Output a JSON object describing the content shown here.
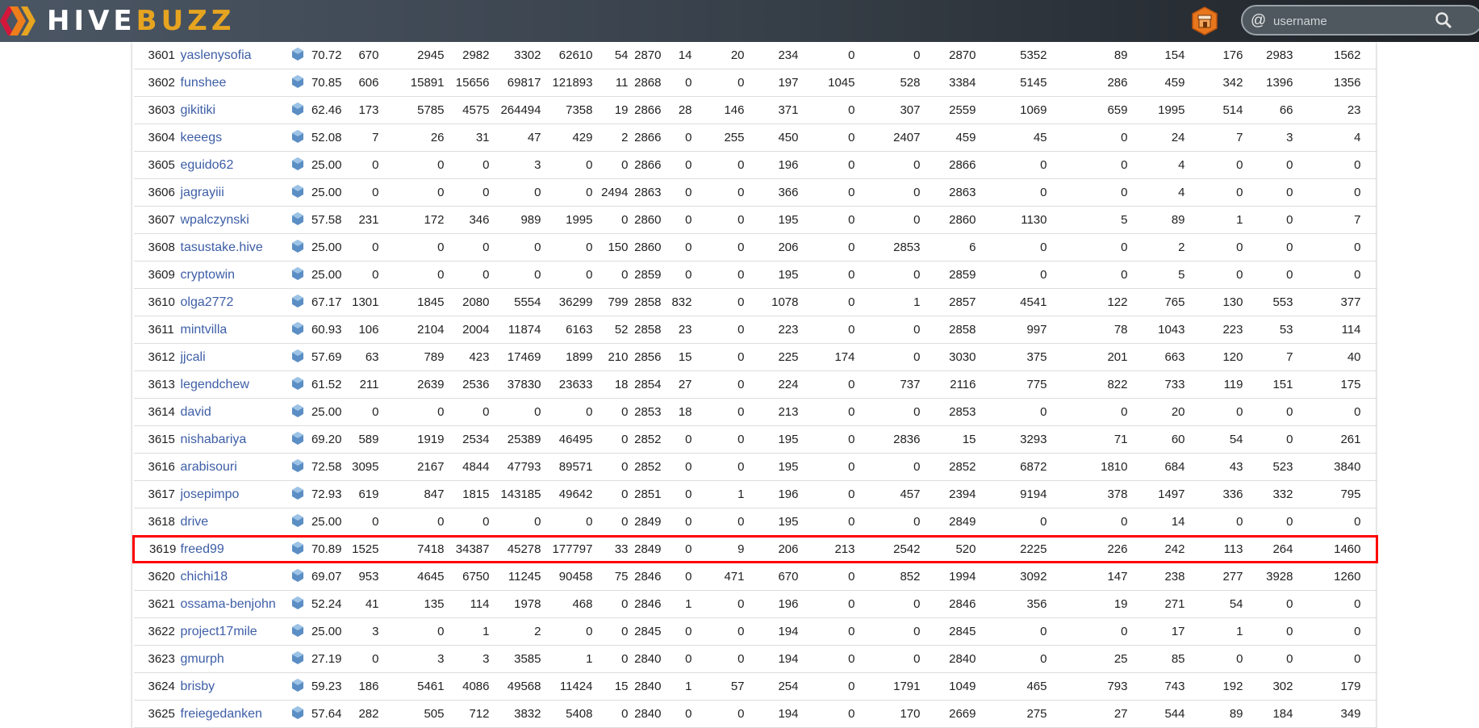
{
  "header": {
    "logo_hive": "HIVE",
    "logo_buzz": "BUZZ",
    "search": {
      "prefix": "@",
      "placeholder": "username"
    },
    "colors": {
      "brand_gold": "#e6a420",
      "link": "#3d5ea6",
      "highlight": "#ff0000"
    }
  },
  "table": {
    "highlighted_rank": "3619",
    "rows": [
      [
        "3601",
        "yaslenysofia",
        "70.72",
        "670",
        "2945",
        "2982",
        "3302",
        "62610",
        "54",
        "2870",
        "14",
        "20",
        "234",
        "0",
        "0",
        "2870",
        "5352",
        "89",
        "154",
        "176",
        "2983",
        "1562"
      ],
      [
        "3602",
        "funshee",
        "70.85",
        "606",
        "15891",
        "15656",
        "69817",
        "121893",
        "11",
        "2868",
        "0",
        "0",
        "197",
        "1045",
        "528",
        "3384",
        "5145",
        "286",
        "459",
        "342",
        "1396",
        "1356"
      ],
      [
        "3603",
        "gikitiki",
        "62.46",
        "173",
        "5785",
        "4575",
        "264494",
        "7358",
        "19",
        "2866",
        "28",
        "146",
        "371",
        "0",
        "307",
        "2559",
        "1069",
        "659",
        "1995",
        "514",
        "66",
        "23"
      ],
      [
        "3604",
        "keeegs",
        "52.08",
        "7",
        "26",
        "31",
        "47",
        "429",
        "2",
        "2866",
        "0",
        "255",
        "450",
        "0",
        "2407",
        "459",
        "45",
        "0",
        "24",
        "7",
        "3",
        "4"
      ],
      [
        "3605",
        "eguido62",
        "25.00",
        "0",
        "0",
        "0",
        "3",
        "0",
        "0",
        "2866",
        "0",
        "0",
        "196",
        "0",
        "0",
        "2866",
        "0",
        "0",
        "4",
        "0",
        "0",
        "0"
      ],
      [
        "3606",
        "jagrayiii",
        "25.00",
        "0",
        "0",
        "0",
        "0",
        "0",
        "2494",
        "2863",
        "0",
        "0",
        "366",
        "0",
        "0",
        "2863",
        "0",
        "0",
        "4",
        "0",
        "0",
        "0"
      ],
      [
        "3607",
        "wpalczynski",
        "57.58",
        "231",
        "172",
        "346",
        "989",
        "1995",
        "0",
        "2860",
        "0",
        "0",
        "195",
        "0",
        "0",
        "2860",
        "1130",
        "5",
        "89",
        "1",
        "0",
        "7"
      ],
      [
        "3608",
        "tasustake.hive",
        "25.00",
        "0",
        "0",
        "0",
        "0",
        "0",
        "150",
        "2860",
        "0",
        "0",
        "206",
        "0",
        "2853",
        "6",
        "0",
        "0",
        "2",
        "0",
        "0",
        "0"
      ],
      [
        "3609",
        "cryptowin",
        "25.00",
        "0",
        "0",
        "0",
        "0",
        "0",
        "0",
        "2859",
        "0",
        "0",
        "195",
        "0",
        "0",
        "2859",
        "0",
        "0",
        "5",
        "0",
        "0",
        "0"
      ],
      [
        "3610",
        "olga2772",
        "67.17",
        "1301",
        "1845",
        "2080",
        "5554",
        "36299",
        "799",
        "2858",
        "832",
        "0",
        "1078",
        "0",
        "1",
        "2857",
        "4541",
        "122",
        "765",
        "130",
        "553",
        "377"
      ],
      [
        "3611",
        "mintvilla",
        "60.93",
        "106",
        "2104",
        "2004",
        "11874",
        "6163",
        "52",
        "2858",
        "23",
        "0",
        "223",
        "0",
        "0",
        "2858",
        "997",
        "78",
        "1043",
        "223",
        "53",
        "114"
      ],
      [
        "3612",
        "jjcali",
        "57.69",
        "63",
        "789",
        "423",
        "17469",
        "1899",
        "210",
        "2856",
        "15",
        "0",
        "225",
        "174",
        "0",
        "3030",
        "375",
        "201",
        "663",
        "120",
        "7",
        "40"
      ],
      [
        "3613",
        "legendchew",
        "61.52",
        "211",
        "2639",
        "2536",
        "37830",
        "23633",
        "18",
        "2854",
        "27",
        "0",
        "224",
        "0",
        "737",
        "2116",
        "775",
        "822",
        "733",
        "119",
        "151",
        "175"
      ],
      [
        "3614",
        "david",
        "25.00",
        "0",
        "0",
        "0",
        "0",
        "0",
        "0",
        "2853",
        "18",
        "0",
        "213",
        "0",
        "0",
        "2853",
        "0",
        "0",
        "20",
        "0",
        "0",
        "0"
      ],
      [
        "3615",
        "nishabariya",
        "69.20",
        "589",
        "1919",
        "2534",
        "25389",
        "46495",
        "0",
        "2852",
        "0",
        "0",
        "195",
        "0",
        "2836",
        "15",
        "3293",
        "71",
        "60",
        "54",
        "0",
        "261"
      ],
      [
        "3616",
        "arabisouri",
        "72.58",
        "3095",
        "2167",
        "4844",
        "47793",
        "89571",
        "0",
        "2852",
        "0",
        "0",
        "195",
        "0",
        "0",
        "2852",
        "6872",
        "1810",
        "684",
        "43",
        "523",
        "3840"
      ],
      [
        "3617",
        "josepimpo",
        "72.93",
        "619",
        "847",
        "1815",
        "143185",
        "49642",
        "0",
        "2851",
        "0",
        "1",
        "196",
        "0",
        "457",
        "2394",
        "9194",
        "378",
        "1497",
        "336",
        "332",
        "795"
      ],
      [
        "3618",
        "drive",
        "25.00",
        "0",
        "0",
        "0",
        "0",
        "0",
        "0",
        "2849",
        "0",
        "0",
        "195",
        "0",
        "0",
        "2849",
        "0",
        "0",
        "14",
        "0",
        "0",
        "0"
      ],
      [
        "3619",
        "freed99",
        "70.89",
        "1525",
        "7418",
        "34387",
        "45278",
        "177797",
        "33",
        "2849",
        "0",
        "9",
        "206",
        "213",
        "2542",
        "520",
        "2225",
        "226",
        "242",
        "113",
        "264",
        "1460"
      ],
      [
        "3620",
        "chichi18",
        "69.07",
        "953",
        "4645",
        "6750",
        "11245",
        "90458",
        "75",
        "2846",
        "0",
        "471",
        "670",
        "0",
        "852",
        "1994",
        "3092",
        "147",
        "238",
        "277",
        "3928",
        "1260"
      ],
      [
        "3621",
        "ossama-benjohn",
        "52.24",
        "41",
        "135",
        "114",
        "1978",
        "468",
        "0",
        "2846",
        "1",
        "0",
        "196",
        "0",
        "0",
        "2846",
        "356",
        "19",
        "271",
        "54",
        "0",
        "0"
      ],
      [
        "3622",
        "project17mile",
        "25.00",
        "3",
        "0",
        "1",
        "2",
        "0",
        "0",
        "2845",
        "0",
        "0",
        "194",
        "0",
        "0",
        "2845",
        "0",
        "0",
        "17",
        "1",
        "0",
        "0"
      ],
      [
        "3623",
        "gmurph",
        "27.19",
        "0",
        "3",
        "3",
        "3585",
        "1",
        "0",
        "2840",
        "0",
        "0",
        "194",
        "0",
        "0",
        "2840",
        "0",
        "25",
        "85",
        "0",
        "0",
        "0"
      ],
      [
        "3624",
        "brisby",
        "59.23",
        "186",
        "5461",
        "4086",
        "49568",
        "11424",
        "15",
        "2840",
        "1",
        "57",
        "254",
        "0",
        "1791",
        "1049",
        "465",
        "793",
        "743",
        "192",
        "302",
        "179"
      ],
      [
        "3625",
        "freiegedanken",
        "57.64",
        "282",
        "505",
        "712",
        "3832",
        "5408",
        "0",
        "2840",
        "0",
        "0",
        "194",
        "0",
        "170",
        "2669",
        "275",
        "27",
        "544",
        "89",
        "184",
        "349"
      ]
    ]
  }
}
